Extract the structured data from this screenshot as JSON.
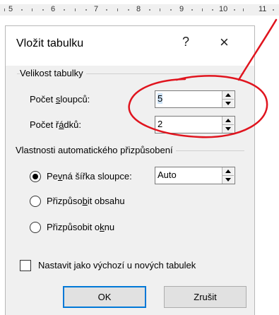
{
  "ruler": {
    "numbers": [
      "5",
      "6",
      "7",
      "8",
      "9",
      "10",
      "11"
    ]
  },
  "dialog": {
    "title": "Vložit tabulku",
    "help_glyph": "?",
    "close_glyph": "×",
    "size_group": {
      "label": "Velikost tabulky",
      "columns_label_pre": "Počet ",
      "columns_label_ul": "s",
      "columns_label_post": "loupců:",
      "columns_value": "5",
      "rows_label_pre": "Počet ř",
      "rows_label_ul": "á",
      "rows_label_post": "dků:",
      "rows_value": "2"
    },
    "autofit_group": {
      "label": "Vlastnosti automatického přizpůsobení",
      "fixed_pre": "Pe",
      "fixed_ul": "v",
      "fixed_post": "ná šířka sloupce:",
      "fixed_value": "Auto",
      "content_pre": "Přizpůso",
      "content_ul": "b",
      "content_post": "it obsahu",
      "window_pre": "Přizpůsobit o",
      "window_ul": "k",
      "window_post": "nu",
      "selected_option": "fixed"
    },
    "default_checkbox": {
      "label": "Nastavit jako výchozí u nových tabulek",
      "checked": false
    },
    "ok_label": "OK",
    "cancel_label": "Zrušit"
  },
  "annotation_color": "#e0141e"
}
